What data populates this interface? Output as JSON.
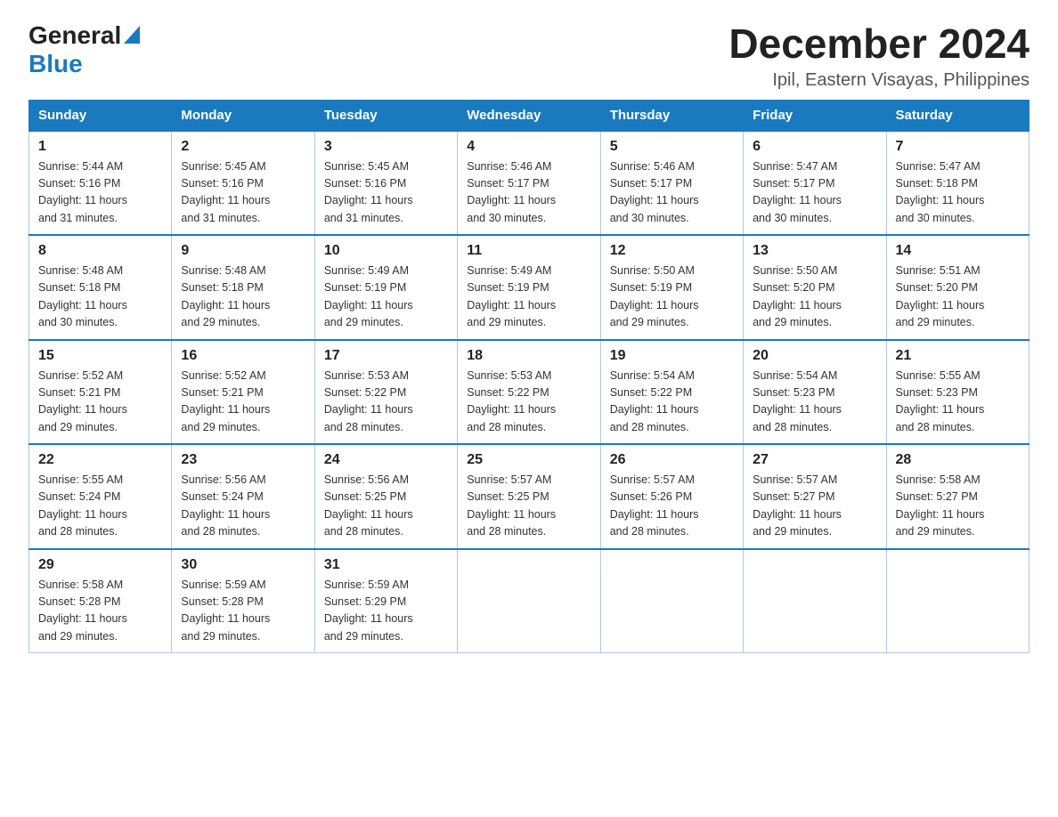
{
  "header": {
    "logo_general": "General",
    "logo_blue": "Blue",
    "title": "December 2024",
    "location": "Ipil, Eastern Visayas, Philippines"
  },
  "days_of_week": [
    "Sunday",
    "Monday",
    "Tuesday",
    "Wednesday",
    "Thursday",
    "Friday",
    "Saturday"
  ],
  "weeks": [
    [
      {
        "day": "1",
        "sunrise": "5:44 AM",
        "sunset": "5:16 PM",
        "daylight": "11 hours and 31 minutes."
      },
      {
        "day": "2",
        "sunrise": "5:45 AM",
        "sunset": "5:16 PM",
        "daylight": "11 hours and 31 minutes."
      },
      {
        "day": "3",
        "sunrise": "5:45 AM",
        "sunset": "5:16 PM",
        "daylight": "11 hours and 31 minutes."
      },
      {
        "day": "4",
        "sunrise": "5:46 AM",
        "sunset": "5:17 PM",
        "daylight": "11 hours and 30 minutes."
      },
      {
        "day": "5",
        "sunrise": "5:46 AM",
        "sunset": "5:17 PM",
        "daylight": "11 hours and 30 minutes."
      },
      {
        "day": "6",
        "sunrise": "5:47 AM",
        "sunset": "5:17 PM",
        "daylight": "11 hours and 30 minutes."
      },
      {
        "day": "7",
        "sunrise": "5:47 AM",
        "sunset": "5:18 PM",
        "daylight": "11 hours and 30 minutes."
      }
    ],
    [
      {
        "day": "8",
        "sunrise": "5:48 AM",
        "sunset": "5:18 PM",
        "daylight": "11 hours and 30 minutes."
      },
      {
        "day": "9",
        "sunrise": "5:48 AM",
        "sunset": "5:18 PM",
        "daylight": "11 hours and 29 minutes."
      },
      {
        "day": "10",
        "sunrise": "5:49 AM",
        "sunset": "5:19 PM",
        "daylight": "11 hours and 29 minutes."
      },
      {
        "day": "11",
        "sunrise": "5:49 AM",
        "sunset": "5:19 PM",
        "daylight": "11 hours and 29 minutes."
      },
      {
        "day": "12",
        "sunrise": "5:50 AM",
        "sunset": "5:19 PM",
        "daylight": "11 hours and 29 minutes."
      },
      {
        "day": "13",
        "sunrise": "5:50 AM",
        "sunset": "5:20 PM",
        "daylight": "11 hours and 29 minutes."
      },
      {
        "day": "14",
        "sunrise": "5:51 AM",
        "sunset": "5:20 PM",
        "daylight": "11 hours and 29 minutes."
      }
    ],
    [
      {
        "day": "15",
        "sunrise": "5:52 AM",
        "sunset": "5:21 PM",
        "daylight": "11 hours and 29 minutes."
      },
      {
        "day": "16",
        "sunrise": "5:52 AM",
        "sunset": "5:21 PM",
        "daylight": "11 hours and 29 minutes."
      },
      {
        "day": "17",
        "sunrise": "5:53 AM",
        "sunset": "5:22 PM",
        "daylight": "11 hours and 28 minutes."
      },
      {
        "day": "18",
        "sunrise": "5:53 AM",
        "sunset": "5:22 PM",
        "daylight": "11 hours and 28 minutes."
      },
      {
        "day": "19",
        "sunrise": "5:54 AM",
        "sunset": "5:22 PM",
        "daylight": "11 hours and 28 minutes."
      },
      {
        "day": "20",
        "sunrise": "5:54 AM",
        "sunset": "5:23 PM",
        "daylight": "11 hours and 28 minutes."
      },
      {
        "day": "21",
        "sunrise": "5:55 AM",
        "sunset": "5:23 PM",
        "daylight": "11 hours and 28 minutes."
      }
    ],
    [
      {
        "day": "22",
        "sunrise": "5:55 AM",
        "sunset": "5:24 PM",
        "daylight": "11 hours and 28 minutes."
      },
      {
        "day": "23",
        "sunrise": "5:56 AM",
        "sunset": "5:24 PM",
        "daylight": "11 hours and 28 minutes."
      },
      {
        "day": "24",
        "sunrise": "5:56 AM",
        "sunset": "5:25 PM",
        "daylight": "11 hours and 28 minutes."
      },
      {
        "day": "25",
        "sunrise": "5:57 AM",
        "sunset": "5:25 PM",
        "daylight": "11 hours and 28 minutes."
      },
      {
        "day": "26",
        "sunrise": "5:57 AM",
        "sunset": "5:26 PM",
        "daylight": "11 hours and 28 minutes."
      },
      {
        "day": "27",
        "sunrise": "5:57 AM",
        "sunset": "5:27 PM",
        "daylight": "11 hours and 29 minutes."
      },
      {
        "day": "28",
        "sunrise": "5:58 AM",
        "sunset": "5:27 PM",
        "daylight": "11 hours and 29 minutes."
      }
    ],
    [
      {
        "day": "29",
        "sunrise": "5:58 AM",
        "sunset": "5:28 PM",
        "daylight": "11 hours and 29 minutes."
      },
      {
        "day": "30",
        "sunrise": "5:59 AM",
        "sunset": "5:28 PM",
        "daylight": "11 hours and 29 minutes."
      },
      {
        "day": "31",
        "sunrise": "5:59 AM",
        "sunset": "5:29 PM",
        "daylight": "11 hours and 29 minutes."
      },
      null,
      null,
      null,
      null
    ]
  ],
  "labels": {
    "sunrise": "Sunrise:",
    "sunset": "Sunset:",
    "daylight": "Daylight:"
  }
}
